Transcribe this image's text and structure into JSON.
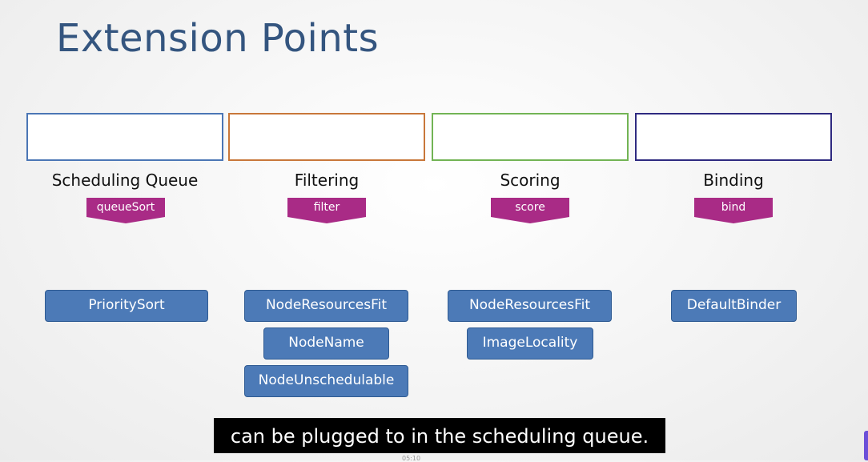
{
  "title": "Extension Points",
  "stages": [
    {
      "label": "Scheduling Queue",
      "extension": "queueSort",
      "border_color": "#4b76b5",
      "plugins": [
        "PrioritySort"
      ]
    },
    {
      "label": "Filtering",
      "extension": "filter",
      "border_color": "#c8773a",
      "plugins": [
        "NodeResourcesFit",
        "NodeName",
        "NodeUnschedulable"
      ]
    },
    {
      "label": "Scoring",
      "extension": "score",
      "border_color": "#72b455",
      "plugins": [
        "NodeResourcesFit",
        "ImageLocality"
      ]
    },
    {
      "label": "Binding",
      "extension": "bind",
      "border_color": "#2e2a80",
      "plugins": [
        "DefaultBinder"
      ]
    }
  ],
  "colors": {
    "title": "#34557f",
    "tag": "#a92b86",
    "plugin_fill": "#4c7ab7",
    "plugin_border": "#2f5b93"
  },
  "caption": "can be plugged to in the scheduling queue.",
  "timestamp": "05:10"
}
